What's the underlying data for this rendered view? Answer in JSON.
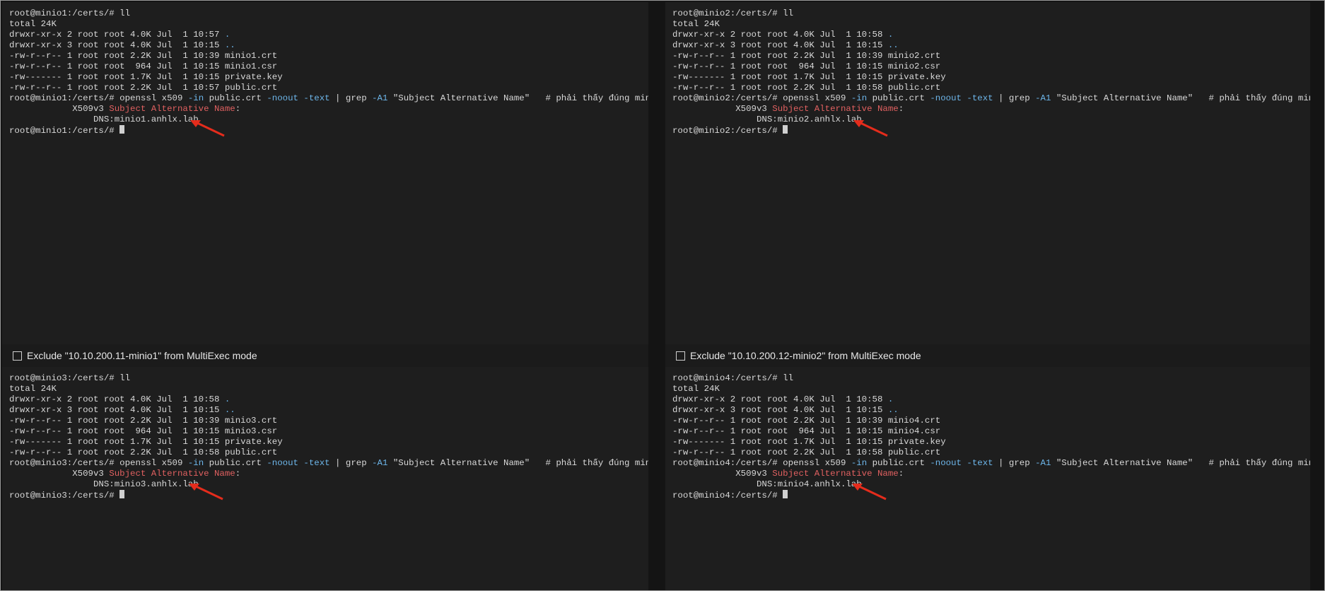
{
  "panes": [
    {
      "prompt": "root@minio1:/certs/# ",
      "command": "ll",
      "total": "total 24K",
      "dir_rows": [
        {
          "meta": "drwxr-xr-x 2 root root 4.0K Jul  1 10:57 ",
          "name": "."
        },
        {
          "meta": "drwxr-xr-x 3 root root 4.0K Jul  1 10:15 ",
          "name": ".."
        }
      ],
      "file_rows": [
        "-rw-r--r-- 1 root root 2.2K Jul  1 10:39 minio1.crt",
        "-rw-r--r-- 1 root root  964 Jul  1 10:15 minio1.csr",
        "-rw------- 1 root root 1.7K Jul  1 10:15 private.key",
        "-rw-r--r-- 1 root root 2.2K Jul  1 10:57 public.crt"
      ],
      "openssl": {
        "a": "openssl x509 ",
        "b": "-in",
        "c": " public.crt ",
        "d": "-noout -text",
        "e": " | grep ",
        "f": "-A1",
        "g": " \"Subject Alternative Name\"   # phải thấy đúng minioX"
      },
      "ext_indent": "            X509v3 ",
      "ext_label": "Subject Alternative Name",
      "ext_colon": ":",
      "dns": "                DNS:minio1.anhlx.lab",
      "final_prompt": "root@minio1:/certs/# "
    },
    {
      "prompt": "root@minio2:/certs/# ",
      "command": "ll",
      "total": "total 24K",
      "dir_rows": [
        {
          "meta": "drwxr-xr-x 2 root root 4.0K Jul  1 10:58 ",
          "name": "."
        },
        {
          "meta": "drwxr-xr-x 3 root root 4.0K Jul  1 10:15 ",
          "name": ".."
        }
      ],
      "file_rows": [
        "-rw-r--r-- 1 root root 2.2K Jul  1 10:39 minio2.crt",
        "-rw-r--r-- 1 root root  964 Jul  1 10:15 minio2.csr",
        "-rw------- 1 root root 1.7K Jul  1 10:15 private.key",
        "-rw-r--r-- 1 root root 2.2K Jul  1 10:58 public.crt"
      ],
      "openssl": {
        "a": "openssl x509 ",
        "b": "-in",
        "c": " public.crt ",
        "d": "-noout -text",
        "e": " | grep ",
        "f": "-A1",
        "g": " \"Subject Alternative Name\"   # phải thấy đúng minioX"
      },
      "ext_indent": "            X509v3 ",
      "ext_label": "Subject Alternative Name",
      "ext_colon": ":",
      "dns": "                DNS:minio2.anhlx.lab",
      "final_prompt": "root@minio2:/certs/# "
    },
    {
      "prompt": "root@minio3:/certs/# ",
      "command": "ll",
      "total": "total 24K",
      "dir_rows": [
        {
          "meta": "drwxr-xr-x 2 root root 4.0K Jul  1 10:58 ",
          "name": "."
        },
        {
          "meta": "drwxr-xr-x 3 root root 4.0K Jul  1 10:15 ",
          "name": ".."
        }
      ],
      "file_rows": [
        "-rw-r--r-- 1 root root 2.2K Jul  1 10:39 minio3.crt",
        "-rw-r--r-- 1 root root  964 Jul  1 10:15 minio3.csr",
        "-rw------- 1 root root 1.7K Jul  1 10:15 private.key",
        "-rw-r--r-- 1 root root 2.2K Jul  1 10:58 public.crt"
      ],
      "openssl": {
        "a": "openssl x509 ",
        "b": "-in",
        "c": " public.crt ",
        "d": "-noout -text",
        "e": " | grep ",
        "f": "-A1",
        "g": " \"Subject Alternative Name\"   # phải thấy đúng minioX"
      },
      "ext_indent": "            X509v3 ",
      "ext_label": "Subject Alternative Name",
      "ext_colon": ":",
      "dns": "                DNS:minio3.anhlx.lab",
      "final_prompt": "root@minio3:/certs/# "
    },
    {
      "prompt": "root@minio4:/certs/# ",
      "command": "ll",
      "total": "total 24K",
      "dir_rows": [
        {
          "meta": "drwxr-xr-x 2 root root 4.0K Jul  1 10:58 ",
          "name": "."
        },
        {
          "meta": "drwxr-xr-x 3 root root 4.0K Jul  1 10:15 ",
          "name": ".."
        }
      ],
      "file_rows": [
        "-rw-r--r-- 1 root root 2.2K Jul  1 10:39 minio4.crt",
        "-rw-r--r-- 1 root root  964 Jul  1 10:15 minio4.csr",
        "-rw------- 1 root root 1.7K Jul  1 10:15 private.key",
        "-rw-r--r-- 1 root root 2.2K Jul  1 10:58 public.crt"
      ],
      "openssl": {
        "a": "openssl x509 ",
        "b": "-in",
        "c": " public.crt ",
        "d": "-noout -text",
        "e": " | grep ",
        "f": "-A1",
        "g": " \"Subject Alternative Name\"   # phải thấy đúng minioX"
      },
      "ext_indent": "            X509v3 ",
      "ext_label": "Subject Alternative Name",
      "ext_colon": ":",
      "dns": "                DNS:minio4.anhlx.lab",
      "final_prompt": "root@minio4:/certs/# "
    }
  ],
  "exclude_bars": [
    {
      "label": "Exclude \"10.10.200.11-minio1\" from MultiExec mode"
    },
    {
      "label": "Exclude \"10.10.200.12-minio2\" from MultiExec mode"
    }
  ],
  "colors": {
    "background": "#1e1e1e",
    "text": "#d8d8d8",
    "highlight_blue": "#6db6ea",
    "highlight_red": "#e06060",
    "annotation_arrow": "#e42c1c"
  }
}
